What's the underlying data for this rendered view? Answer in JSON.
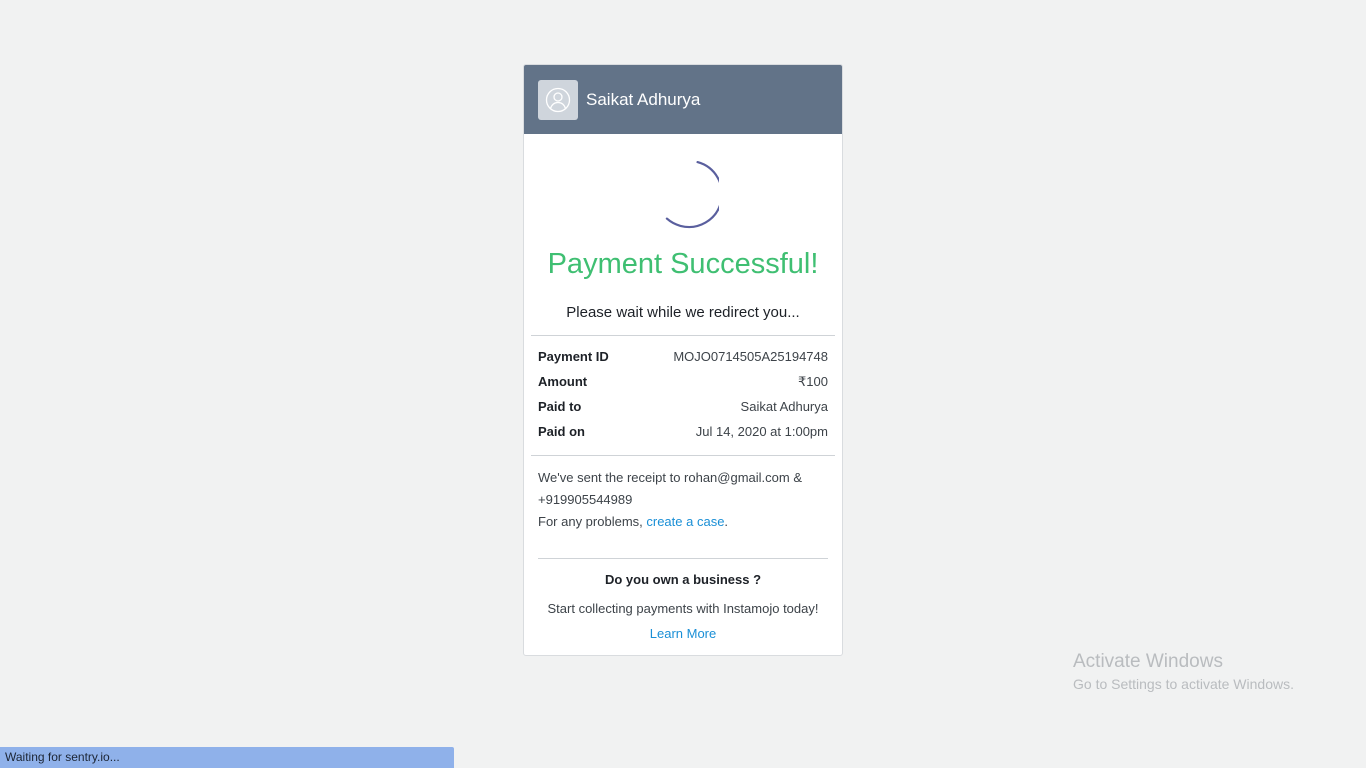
{
  "header": {
    "seller_name": "Saikat Adhurya",
    "avatar_icon": "user-avatar-icon"
  },
  "status": {
    "spinner_icon": "loading-spinner-icon",
    "title": "Payment Successful!",
    "subtitle": "Please wait while we redirect you..."
  },
  "details": [
    {
      "label": "Payment ID",
      "value": "MOJO0714505A25194748"
    },
    {
      "label": "Amount",
      "value": "₹100"
    },
    {
      "label": "Paid to",
      "value": "Saikat Adhurya"
    },
    {
      "label": "Paid on",
      "value": "Jul 14, 2020 at 1:00pm"
    }
  ],
  "receipt": {
    "line1": "We've sent the receipt to rohan@gmail.com & +919905544989",
    "problems_prefix": "For any problems, ",
    "create_case_link": "create a case",
    "problems_suffix": "."
  },
  "business": {
    "title": "Do you own a business ?",
    "text": "Start collecting payments with Instamojo today!",
    "learn_more": "Learn More"
  },
  "watermark": {
    "title": "Activate Windows",
    "subtitle": "Go to Settings to activate Windows."
  },
  "statusbar": {
    "text": "Waiting for sentry.io..."
  },
  "colors": {
    "header_bg": "#627388",
    "success_green": "#3fbf72",
    "link_blue": "#1a8fd6",
    "spinner": "#5a5f9e",
    "statusbar_bg": "#8fb1ea"
  }
}
